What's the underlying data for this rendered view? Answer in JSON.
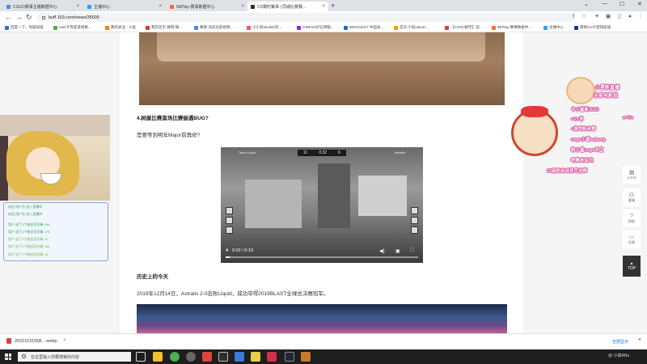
{
  "tabs": [
    {
      "label": "CSGO赛事主播数据中心",
      "active": false,
      "color": "#4a8de0"
    },
    {
      "label": "主播中心",
      "active": false,
      "color": "#2aa1ff"
    },
    {
      "label": "5EPlay-赛事数据中心",
      "active": false,
      "color": "#ff6b2a"
    },
    {
      "label": "CS赛时策事 | 同城比赛赛...",
      "active": true,
      "color": "#2c2c2c"
    }
  ],
  "toolbar": {
    "url": "buff.163.com/news/35505"
  },
  "bookmarks": [
    {
      "label": "百度一下，你就知道",
      "color": "#2f6ee0"
    },
    {
      "label": "user元宵蛋道请那...",
      "color": "#4caf50"
    },
    {
      "label": "我的关注 - 斗鱼",
      "color": "#ff7a00"
    },
    {
      "label": "我的首页 微博-随...",
      "color": "#e0302a"
    },
    {
      "label": "蜂窝-动态化影视频...",
      "color": "#3a88ff"
    },
    {
      "label": "小小恐ukulele资...",
      "color": "#ff4d6a"
    },
    {
      "label": "CWESG护石神殿...",
      "color": "#8a2be2"
    },
    {
      "label": "WESG2017 中国总...",
      "color": "#1f6fd1"
    },
    {
      "label": "首页-小钻valure-...",
      "color": "#ff9800"
    },
    {
      "label": "【CSGO赋字】前...",
      "color": "#e03a3a"
    },
    {
      "label": "5EPlay-赛事数据中...",
      "color": "#ff6b2a"
    },
    {
      "label": "主播中心",
      "color": "#2aa1ff"
    },
    {
      "label": "网易UU计游戏加速...",
      "color": "#0e3b8a"
    }
  ],
  "article": {
    "heading": "4.树屋比赛直场比赛偷遇BUG?",
    "para1": "是要等到明年Major前再修?",
    "history_heading": "历史上的今天",
    "history_text": "2019年12月14日，Astralis 2-0击败Liquid，成功夺得2019BLAST全球总决赛冠军。"
  },
  "video": {
    "hud_left": "11",
    "hud_time": "0:32",
    "hud_right": "6",
    "team_left": "Team Liquid",
    "team_right": "Astralis",
    "time": "0:02 / 0:19",
    "progress": 0.02
  },
  "sidebar": {
    "items": [
      {
        "label": "公众号",
        "icon": "qr-icon"
      },
      {
        "label": "客服",
        "icon": "headset-icon"
      },
      {
        "label": "帮助",
        "icon": "question-icon"
      },
      {
        "label": "反馈",
        "icon": "feedback-icon"
      }
    ],
    "top_label": "TOP"
  },
  "stream_chat": [
    {
      "text": "欢迎 用户名 进入直播间",
      "color": "#3aa84a"
    },
    {
      "text": "欢迎 用户名 进入直播间",
      "color": "#3aa84a"
    },
    {
      "text": "用户 送了1个粉丝荧光棒 ×50",
      "color": "#2aa84a"
    },
    {
      "text": "用户 送了1个粉丝荧光棒 ×70",
      "color": "#2aa84a"
    },
    {
      "text": "用户 送了1个粉丝荧光棒 ×2",
      "color": "#5bbf3a"
    },
    {
      "text": "用户 送了1个粉丝荧光棒 ×60",
      "color": "#5bbf3a"
    },
    {
      "text": "用户 送了1个粉丝荧光棒 ×8",
      "color": "#5bbf3a"
    }
  ],
  "overlay": {
    "title1": "小星新直播",
    "title2": "全能电影投",
    "lines": [
      "今小星新2023",
      "=Vx号",
      "v=Vx",
      "=游戏粉丝群",
      "csgo小星sqkurg",
      "粉小星csgo专区",
      "吧赛老站讯",
      "12级粉丝成员可进群"
    ]
  },
  "downloads": {
    "file": "20221131558....webp",
    "show_all": "全部显示"
  },
  "taskbar": {
    "search_placeholder": "在这里输入你要搜索的内容",
    "time": "@ 小高AHu"
  }
}
